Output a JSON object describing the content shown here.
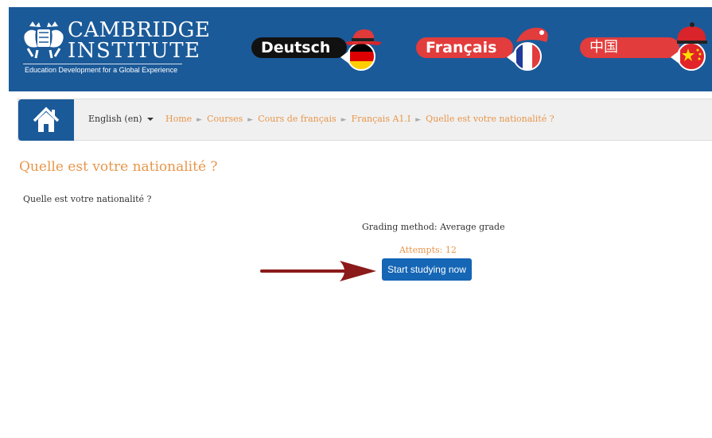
{
  "header": {
    "logo_line1": "CAMBRIDGE",
    "logo_line2": "INSTITUTE",
    "logo_tagline": "Education Development for a Global Experience",
    "languages": [
      {
        "label": "Deutsch"
      },
      {
        "label": "Français"
      },
      {
        "label": "中国"
      }
    ]
  },
  "nav": {
    "language_selector": "English (en)",
    "breadcrumb": [
      "Home",
      "Courses",
      "Cours de français",
      "Français A1.I",
      "Quelle est votre nationalité ?"
    ]
  },
  "main": {
    "title": "Quelle est votre nationalité ?",
    "intro": "Quelle est votre nationalité ?",
    "grading_method": "Grading method: Average grade",
    "attempts": "Attempts: 12",
    "start_button": "Start studying now"
  },
  "colors": {
    "banner": "#1b5a99",
    "accent_orange": "#e8964a",
    "button_blue": "#1566b5",
    "arrow": "#8b1a1a"
  }
}
